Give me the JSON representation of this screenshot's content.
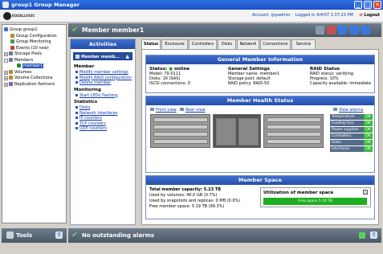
{
  "window": {
    "title": "group1 Group Manager",
    "min": "_",
    "max": "□",
    "close": "✕"
  },
  "header": {
    "logo_text": "EQUALLOGIC",
    "account": "Account: grpadmin",
    "logged_in": "Logged in 4/4/07 1:37:23 PM",
    "logout": "Logout"
  },
  "tree": [
    {
      "label": "Group group1",
      "level": 0,
      "icon_color": "#3a6fd0"
    },
    {
      "label": "Group Configuration",
      "level": 1,
      "icon_color": "#b58b2a"
    },
    {
      "label": "Group Monitoring",
      "level": 1,
      "icon_color": "#4a9a4a"
    },
    {
      "label": "Events (10 new)",
      "level": 1,
      "icon_color": "#c04040"
    },
    {
      "label": "Storage Pools",
      "level": 0,
      "icon_color": "#6a7a9a",
      "expander": "+"
    },
    {
      "label": "Members",
      "level": 0,
      "icon_color": "#6a7a9a",
      "expander": "-"
    },
    {
      "label": "member1",
      "level": 2,
      "icon_color": "#2a8a2a",
      "selected": true
    },
    {
      "label": "Volumes",
      "level": 0,
      "icon_color": "#b58b2a",
      "expander": "+"
    },
    {
      "label": "Volume Collections",
      "level": 0,
      "icon_color": "#b58b2a",
      "expander": "+"
    },
    {
      "label": "Replication Partners",
      "level": 0,
      "icon_color": "#8a5ab0",
      "expander": "+"
    }
  ],
  "tools": {
    "label": "Tools",
    "arrow": "⇧"
  },
  "member_header": {
    "title": "Member member1"
  },
  "activities": {
    "title": "Activities",
    "sub_header": "Member memb...",
    "sub_arrow": "▲",
    "sections": [
      {
        "heading": "Member",
        "links": [
          "Modify member settings",
          "Modify RAID configuration",
          "Delete member"
        ]
      },
      {
        "heading": "Monitoring",
        "links": [
          "Start LEDs flashing"
        ]
      },
      {
        "heading": "Statistics",
        "links": [
          "Disks",
          "Network interfaces",
          "IP counters",
          "TCP counters",
          "UDP counters"
        ]
      }
    ]
  },
  "tabs": [
    "Status",
    "Enclosure",
    "Controllers",
    "Disks",
    "Network",
    "Connections",
    "Service"
  ],
  "general": {
    "title": "General Member Information",
    "status": {
      "heading": "Status:",
      "value": "online",
      "lines": [
        "Model: 70-0111",
        "Disks: 16 (SAS)",
        "iSCSI connections: 0"
      ]
    },
    "settings": {
      "heading": "General Settings",
      "lines": [
        "Member name: member1",
        "Storage pool: default",
        "RAID policy: RAID-50"
      ]
    },
    "raid": {
      "heading": "RAID Status",
      "lines": [
        "RAID status: verifying",
        "Progress: 10%",
        "Capacity available: immediate"
      ]
    }
  },
  "health": {
    "title": "Member Health Status",
    "front_view": "Front view",
    "rear_view": "Rear view",
    "view_alarms": "View alarms",
    "rows": [
      {
        "label": "Temperature",
        "status": "OK"
      },
      {
        "label": "Cooling fans",
        "status": "OK"
      },
      {
        "label": "Power supplies",
        "status": "OK"
      },
      {
        "label": "Controllers",
        "status": "OK"
      },
      {
        "label": "Disks",
        "status": "OK"
      },
      {
        "label": "Interfaces",
        "status": "OK"
      }
    ]
  },
  "space": {
    "title": "Member Space",
    "total": "Total member capacity: 5.23 TB",
    "lines": [
      "Used by volumes: 40.0 GB (0.7%)",
      "Used by snapshots and replicas: 0 MB (0.0%)",
      "Free member space: 5.19 TB (99.3%)"
    ],
    "util_title": "Utilization of member space",
    "bar_label": "Free space 5.19 TB",
    "free_fraction": 0.993
  },
  "status_bar": {
    "text": "No outstanding alarms"
  }
}
